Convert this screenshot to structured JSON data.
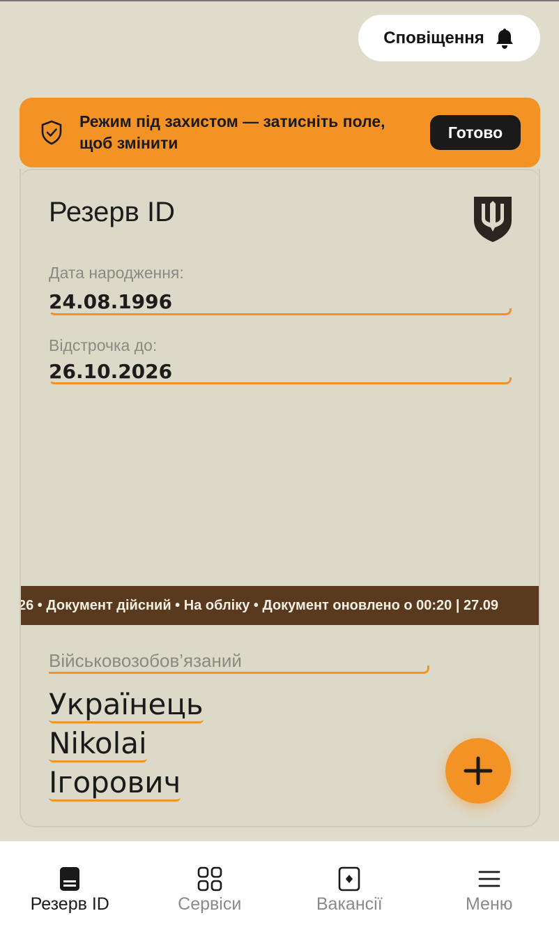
{
  "header": {
    "notifications_label": "Сповіщення"
  },
  "banner": {
    "text": "Режим під захистом — затисніть поле, щоб змінити",
    "done_label": "Готово"
  },
  "card": {
    "title": "Резерв ID",
    "fields": [
      {
        "label": "Дата народження:",
        "value": "24.08.1996"
      },
      {
        "label": "Відстрочка до:",
        "value": "26.10.2026"
      }
    ],
    "ticker": "26 • Документ дійсний • На обліку • Документ оновлено о 00:20 | 27.09",
    "status": "Військовозобов’язаний",
    "name": {
      "surname": "Українець",
      "given": "Nikolai",
      "patronymic": "Ігорович"
    }
  },
  "nav": {
    "items": [
      {
        "label": "Резерв ID",
        "icon": "reserve-id-icon",
        "active": true
      },
      {
        "label": "Сервіси",
        "icon": "services-grid-icon",
        "active": false
      },
      {
        "label": "Вакансії",
        "icon": "vacancies-icon",
        "active": false
      },
      {
        "label": "Меню",
        "icon": "menu-icon",
        "active": false
      }
    ]
  },
  "colors": {
    "accent": "#f39325",
    "background": "#e0dccc",
    "ticker_bg": "#5a3a1e",
    "text_dark": "#1a1a1a",
    "text_muted": "#8a8a82"
  }
}
